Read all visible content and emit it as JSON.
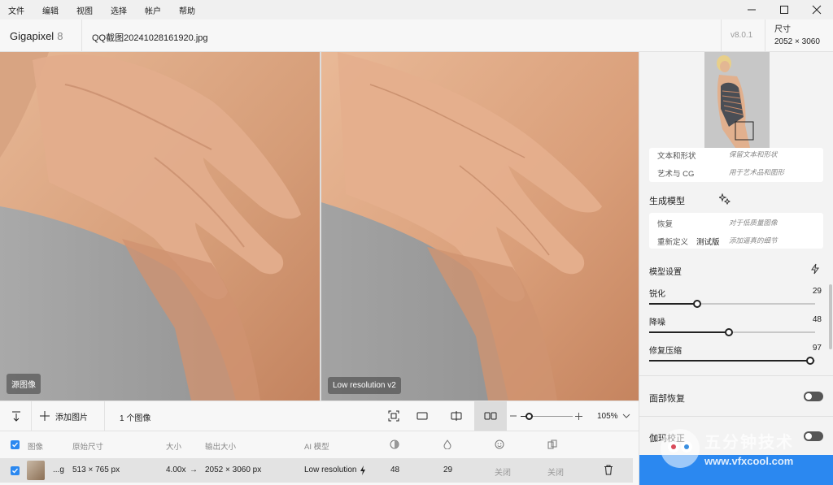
{
  "menubar": {
    "items": [
      "文件",
      "编辑",
      "视图",
      "选择",
      "帐户",
      "帮助"
    ]
  },
  "window": {
    "minimize_icon": "minimize-icon",
    "maximize_icon": "maximize-icon",
    "close_icon": "close-icon"
  },
  "titlebar": {
    "app_name": "Gigapixel",
    "app_major": "8",
    "filename": "QQ截图20241028161920.jpg",
    "version": "v8.0.1",
    "size_label": "尺寸",
    "size_value": "2052 × 3060"
  },
  "preview": {
    "left_label": "源图像",
    "right_label": "Low resolution v2"
  },
  "right_panel": {
    "style_rows": [
      {
        "name": "文本和形状",
        "desc": "保留文本和形状"
      },
      {
        "name": "艺术与 CG",
        "desc": "用于艺术品和图形"
      }
    ],
    "generative_title": "生成模型",
    "generative_rows": [
      {
        "name": "恢复",
        "desc": "对于低质量图像",
        "badge": ""
      },
      {
        "name": "重新定义",
        "desc": "添加逼真的细节",
        "badge": "测试版"
      }
    ],
    "model_settings_title": "模型设置",
    "sliders": [
      {
        "label": "锐化",
        "value": "29",
        "fraction": 0.29
      },
      {
        "label": "降噪",
        "value": "48",
        "fraction": 0.48
      },
      {
        "label": "修复压缩",
        "value": "97",
        "fraction": 0.97
      }
    ],
    "face_recovery_label": "面部恢复",
    "gamma_label": "伽玛校正"
  },
  "toolbar": {
    "add_image_label": "添加图片",
    "image_count": "1 个图像",
    "zoom_value": "105%",
    "zoom_fraction": 0.15
  },
  "table": {
    "headers": {
      "image": "图像",
      "original_size": "原始尺寸",
      "scale": "大小",
      "output_size": "输出大小",
      "ai_model": "AI 模型"
    },
    "row": {
      "filename_short": "...g",
      "original_size": "513 × 765 px",
      "scale": "4.00x",
      "arrow": "→",
      "output_size": "2052 × 3060 px",
      "ai_model": "Low resolution",
      "sharpen": "48",
      "denoise": "29",
      "face": "关闭",
      "gamma": "关闭"
    }
  },
  "watermark": {
    "title": "五分钟技术",
    "url": "www.vfxcool.com"
  }
}
